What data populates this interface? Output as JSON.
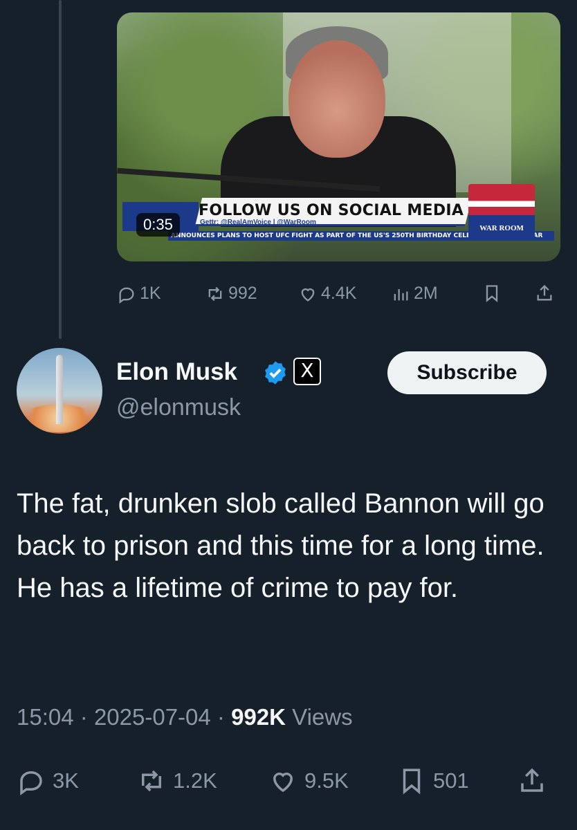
{
  "quoted_video": {
    "duration": "0:35",
    "chyron_title": "FOLLOW US ON SOCIAL MEDIA",
    "chyron_handles": "Gettr: @RealAmVoice | @WarRoom",
    "chyron_ticker": "ANNOUNCES PLANS TO HOST UFC FIGHT AS PART OF THE US'S 250TH BIRTHDAY CELEBRATION NEXT YEAR",
    "logo_text": "WAR ROOM"
  },
  "quoted_stats": {
    "replies": "1K",
    "reposts": "992",
    "likes": "4.4K",
    "views": "2M"
  },
  "author": {
    "name": "Elon Musk",
    "handle": "@elonmusk",
    "subscribe_label": "Subscribe",
    "x_badge": "X"
  },
  "tweet": {
    "text": "The fat, drunken slob called Bannon will go back to prison and this time for a long time. He has a lifetime of crime to pay for.",
    "time": "15:04",
    "date": "2025-07-04",
    "views_count": "992K",
    "views_label": "Views"
  },
  "stats": {
    "replies": "3K",
    "reposts": "1.2K",
    "likes": "9.5K",
    "bookmarks": "501"
  },
  "colors": {
    "background": "#15202b",
    "text": "#f7f9f9",
    "muted": "#8b98a5",
    "verified": "#1d9bf0"
  }
}
